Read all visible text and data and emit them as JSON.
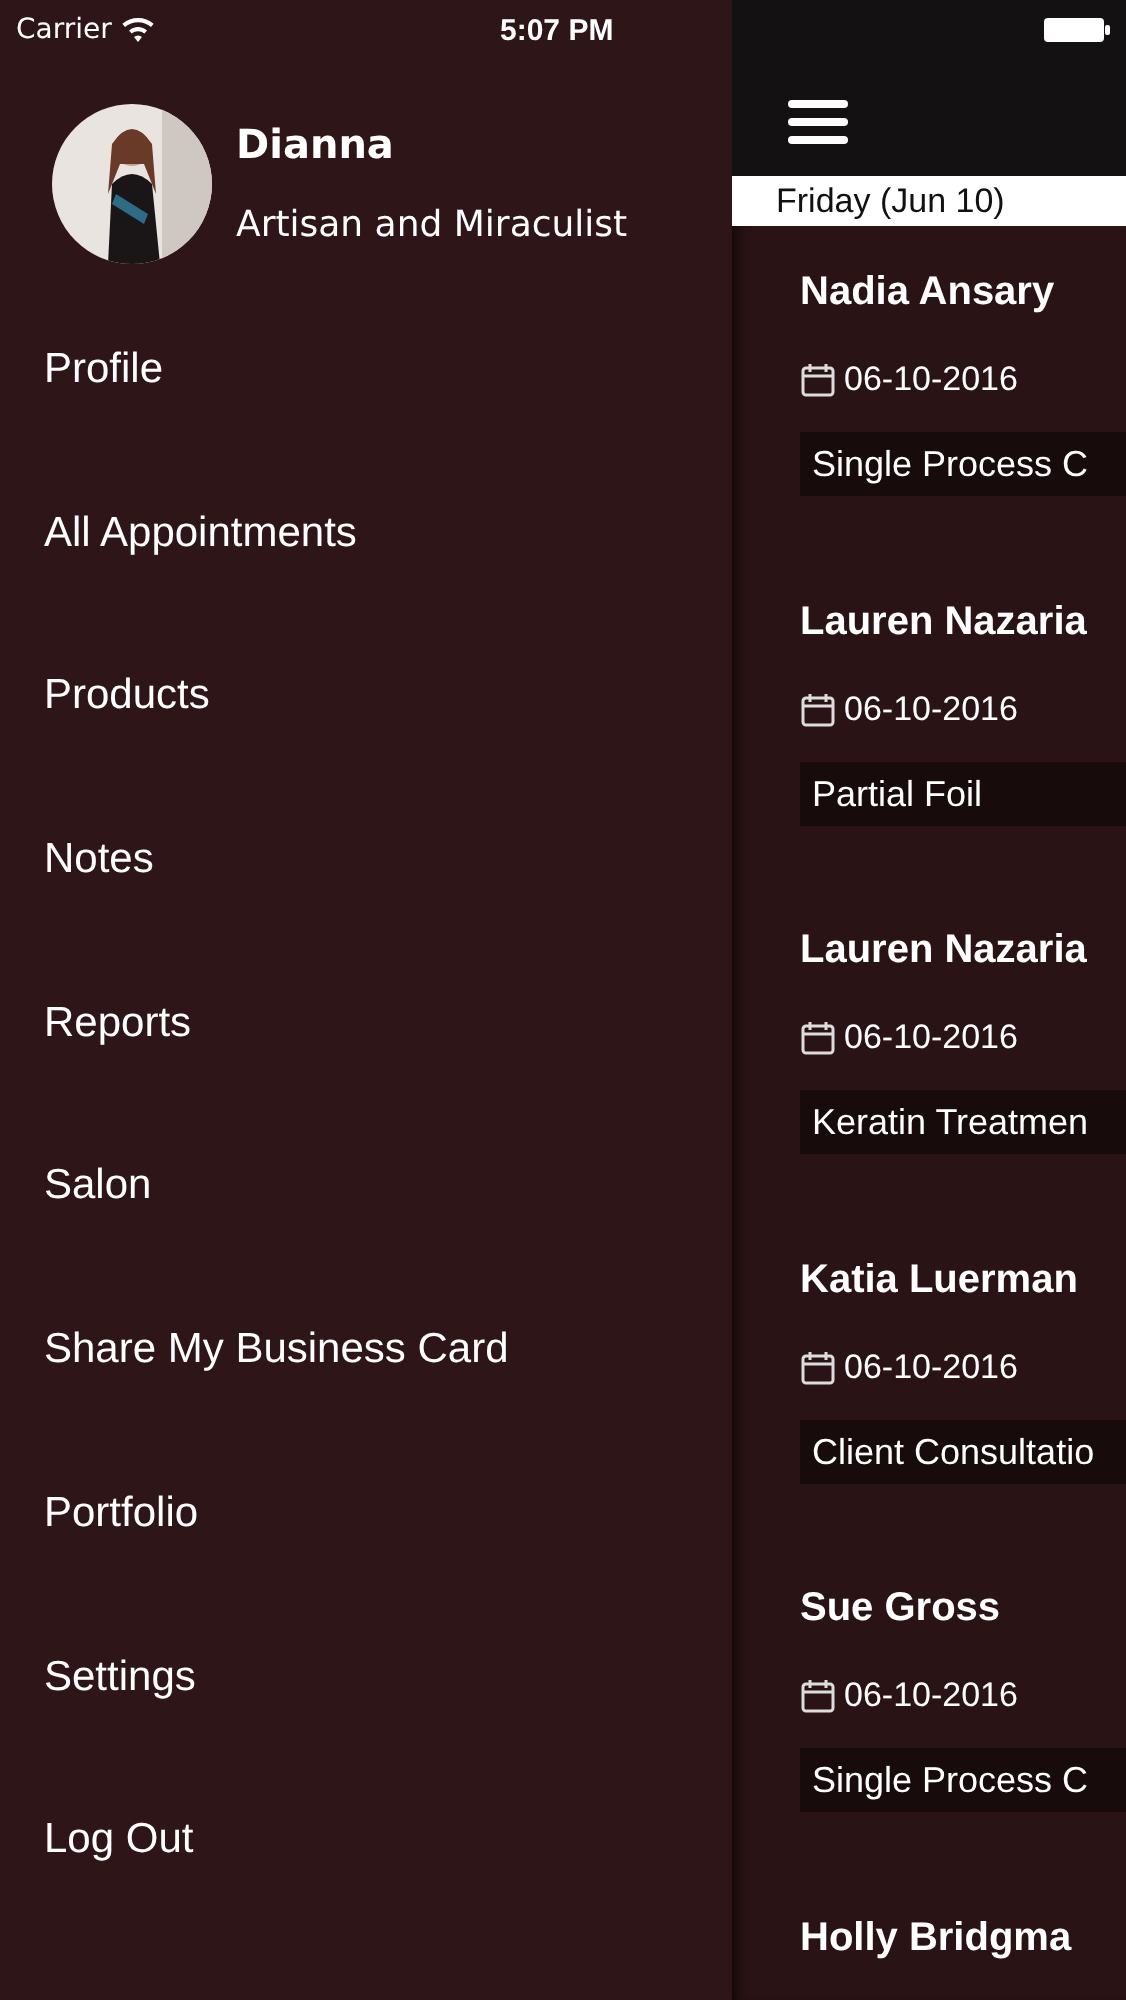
{
  "status_bar": {
    "carrier": "Carrier",
    "time": "5:07 PM"
  },
  "profile": {
    "name": "Dianna",
    "subtitle": "Artisan and Miraculist"
  },
  "menu": {
    "items": [
      {
        "label": "Profile"
      },
      {
        "label": "All Appointments"
      },
      {
        "label": "Products"
      },
      {
        "label": "Notes"
      },
      {
        "label": "Reports"
      },
      {
        "label": "Salon"
      },
      {
        "label": "Share My Business Card"
      },
      {
        "label": "Portfolio"
      },
      {
        "label": "Settings"
      },
      {
        "label": "Log Out"
      }
    ]
  },
  "day_header": "Friday (Jun 10)",
  "appointments": [
    {
      "client": "Nadia Ansary",
      "date": "06-10-2016",
      "service": "Single Process C"
    },
    {
      "client": "Lauren Nazaria",
      "date": "06-10-2016",
      "service": "Partial Foil"
    },
    {
      "client": "Lauren Nazaria",
      "date": "06-10-2016",
      "service": "Keratin Treatmen"
    },
    {
      "client": "Katia Luerman",
      "date": "06-10-2016",
      "service": "Client Consultatio"
    },
    {
      "client": "Sue Gross",
      "date": "06-10-2016",
      "service": "Single Process C"
    },
    {
      "client": "Holly Bridgma"
    }
  ]
}
